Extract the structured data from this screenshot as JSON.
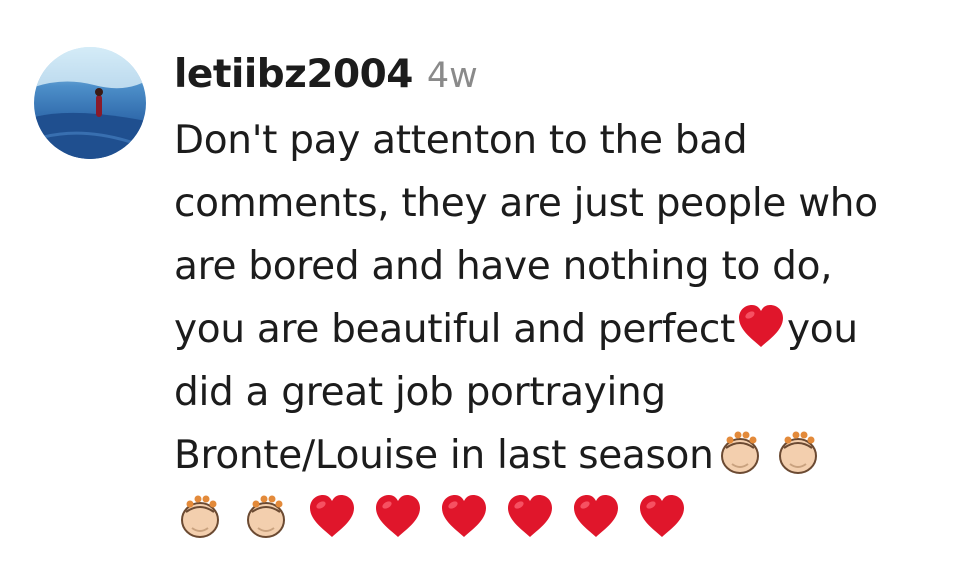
{
  "comment": {
    "username": "letiibz2004",
    "timestamp": "4w",
    "avatar_icon": "profile-photo",
    "lines": [
      "Don't pay attenton to the bad",
      "comments, they are just people who",
      "are bored and have nothing to do,",
      "you are beautiful and perfect",
      "you",
      "did a great job portraying",
      "Bronte/Louise in last season"
    ],
    "emojis": {
      "heart": "❤️",
      "clap": "👏"
    },
    "trailing_emojis": [
      "👏",
      "👏",
      "❤️",
      "❤️",
      "❤️",
      "❤️",
      "❤️",
      "❤️"
    ]
  },
  "colors": {
    "heart_red": "#e0162b",
    "clap_skin": "#f3cfae",
    "username": "#1c1c1c",
    "timestamp": "#8a8a8a"
  }
}
